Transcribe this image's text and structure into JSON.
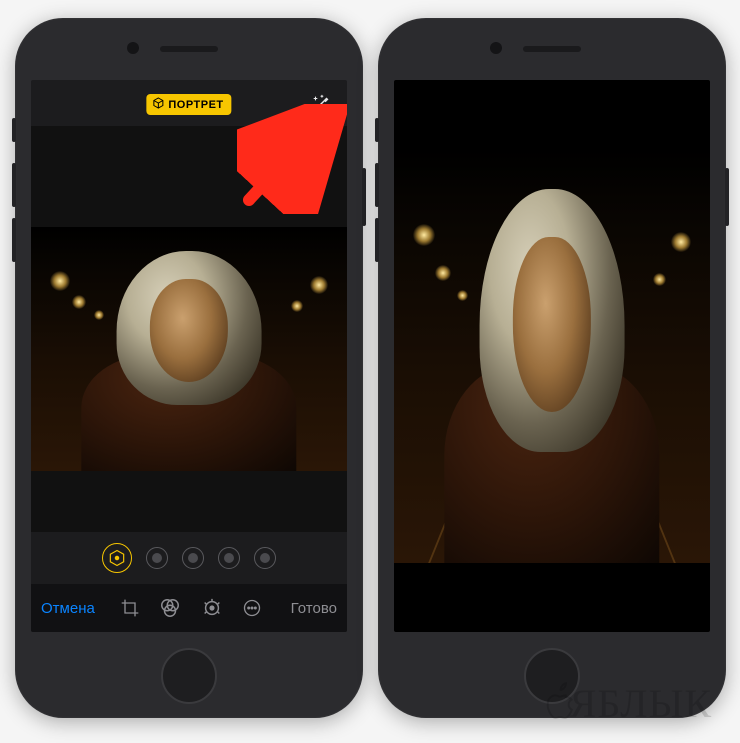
{
  "portrait_badge": {
    "label": "ПОРТРЕТ"
  },
  "wand": {
    "name": "magic-wand-icon"
  },
  "lighting": {
    "options": [
      {
        "selected": true
      },
      {
        "selected": false
      },
      {
        "selected": false
      },
      {
        "selected": false
      },
      {
        "selected": false
      }
    ]
  },
  "toolbar": {
    "cancel_label": "Отмена",
    "done_label": "Готово"
  },
  "watermark": {
    "text": "ЯБЛЫК"
  },
  "arrow": {
    "color": "#ff2a1a"
  }
}
